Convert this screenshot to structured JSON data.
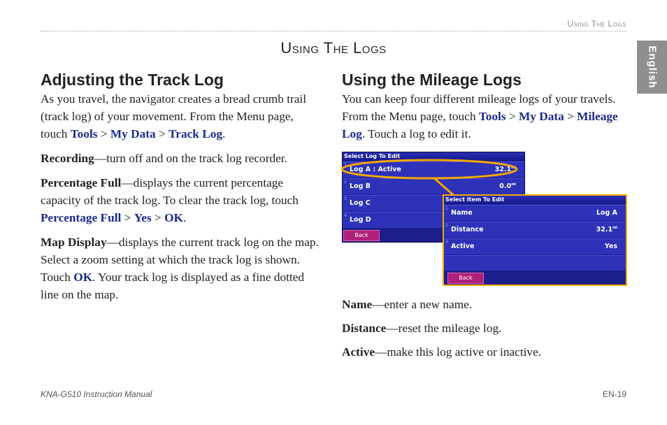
{
  "header": {
    "running_title": "Using The Logs"
  },
  "section_title": "Using The Logs",
  "language_tab": "English",
  "left": {
    "heading": "Adjusting the Track Log",
    "intro": {
      "text1": "As you travel, the navigator creates a bread crumb trail (track log) of your movement. From the Menu page, touch ",
      "link1": "Tools",
      "sep1": " > ",
      "link2": "My Data",
      "sep2": " > ",
      "link3": "Track Log",
      "end": "."
    },
    "recording": {
      "term": "Recording",
      "text": "—turn off and on the track log recorder."
    },
    "percentage": {
      "term": "Percentage Full",
      "text": "—displays the current percentage capacity of the track log. To clear the track log, touch ",
      "link1": "Percentage Full",
      "sep1": " > ",
      "link2": "Yes",
      "sep2": " > ",
      "link3": "OK",
      "end": "."
    },
    "map_display": {
      "term": "Map Display",
      "text1": "—displays the current track log on the map. Select a zoom setting at which the track log is shown. Touch ",
      "link": "OK",
      "text2": ". Your track log is displayed as a fine dotted line on the map."
    }
  },
  "right": {
    "heading": "Using the Mileage Logs",
    "intro": {
      "text1": "You can keep four different mileage logs of your travels. From the Menu page, touch ",
      "link1": "Tools",
      "sep1": " > ",
      "link2": "My Data",
      "sep2": " > ",
      "link3": "Mileage Log",
      "text2": ". Touch a log to edit it."
    },
    "name": {
      "term": "Name",
      "text": "—enter a new name."
    },
    "distance": {
      "term": "Distance",
      "text": "—reset the mileage log."
    },
    "active": {
      "term": "Active",
      "text": "—make this log active or inactive."
    }
  },
  "screen1": {
    "title": "Select Log To Edit",
    "rows": [
      {
        "num": "1",
        "label": "Log A : Active",
        "value": "32.1",
        "unit": "mi"
      },
      {
        "num": "2",
        "label": "Log B",
        "value": "0.0",
        "unit": "mi"
      },
      {
        "num": "3",
        "label": "Log C",
        "value": "",
        "unit": ""
      },
      {
        "num": "4",
        "label": "Log D",
        "value": "",
        "unit": ""
      }
    ],
    "back": "Back"
  },
  "screen2": {
    "title": "Select Item To Edit",
    "rows": [
      {
        "num": "1",
        "label": "Name",
        "value": "Log A"
      },
      {
        "num": "2",
        "label": "Distance",
        "value": "32.1",
        "unit": "mi"
      },
      {
        "num": "3",
        "label": "Active",
        "value": "Yes"
      }
    ],
    "back": "Back"
  },
  "colors": {
    "link": "#1a2a8c",
    "highlight": "#f5a800",
    "screen_bg": "#1c1f8a",
    "tab": "#8f8f8f"
  },
  "footer": {
    "manual": "KNA-G510 Instruction Manual",
    "page": "EN-19"
  }
}
